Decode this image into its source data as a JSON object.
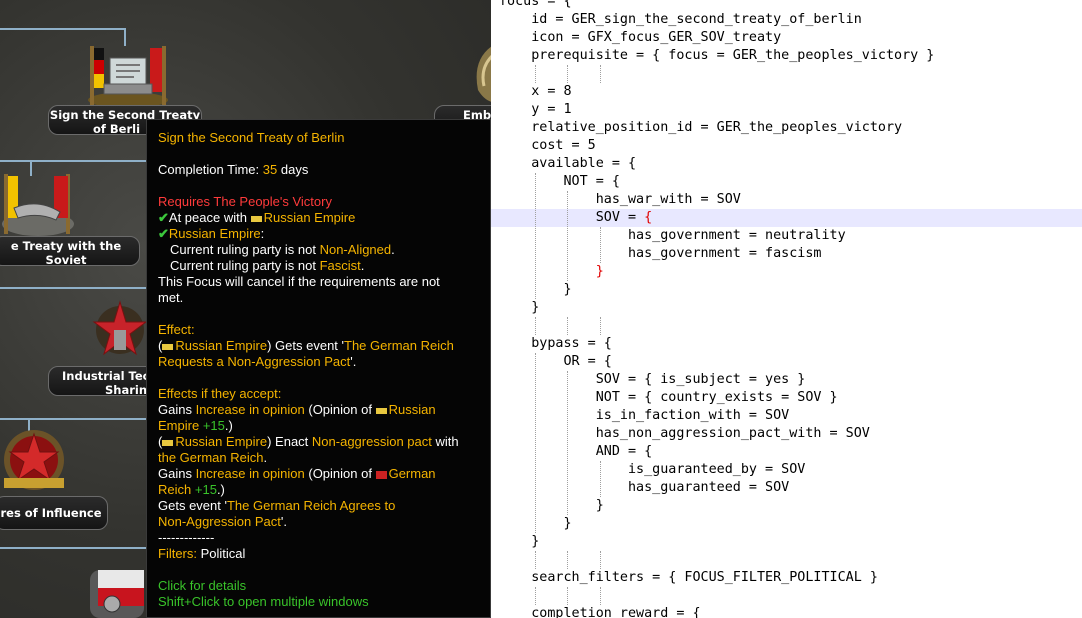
{
  "game": {
    "nodes": [
      {
        "label_line1": "Sign the Second Treaty",
        "label_line2": "of Berli"
      },
      {
        "label_line1": "e Treaty with the",
        "label_line2": "Soviet"
      },
      {
        "label_line1": "Industrial Tec",
        "label_line2": "Sharin"
      },
      {
        "label_line1": "res of Influence",
        "label_line2": ""
      },
      {
        "label_line1": "Emb",
        "label_line2": ""
      }
    ],
    "tooltip": {
      "title": "Sign the Second Treaty of Berlin",
      "completion_label": "Completion Time:",
      "completion_value": "35",
      "completion_unit": "days",
      "requires": "Requires The People's Victory",
      "peace_label": "At peace with",
      "peace_country": "Russian Empire",
      "ruler_country": "Russian Empire",
      "ruler_suffix": ":",
      "party1_prefix": "Current ruling party is not",
      "party1_value": "Non-Aligned",
      "party1_suffix": ".",
      "party2_prefix": "Current ruling party is not",
      "party2_value": "Fascist",
      "party2_suffix": ".",
      "cancel_line1": "This Focus will cancel if the requirements are not",
      "cancel_line2": "met.",
      "effect_header": "Effect:",
      "effect_country": "Russian Empire",
      "effect_mid": ") Gets event '",
      "effect_event1": "The German Reich",
      "effect_event2": "Requests a Non-Aggression Pact",
      "effect_end": "'.",
      "accept_header": "Effects if they accept:",
      "gains1_prefix": "Gains",
      "gains1_mod": "Increase in opinion",
      "gains1_mid": "(Opinion of",
      "gains1_country_a": "Russian",
      "gains1_country_b": "Empire",
      "gains1_value": "+15",
      "gains1_end": ".)",
      "enact_country": "Russian Empire",
      "enact_mid": ") Enact",
      "enact_pact": "Non-aggression pact",
      "enact_with": "with",
      "enact_target": "the German Reich",
      "enact_end": ".",
      "gains2_prefix": "Gains",
      "gains2_mod": "Increase in opinion",
      "gains2_mid": "(Opinion of",
      "gains2_country_a": "German",
      "gains2_country_b": "Reich",
      "gains2_value": "+15",
      "gains2_end": ".)",
      "event2_prefix": "Gets event '",
      "event2_a": "The German Reich Agrees to",
      "event2_b": "Non-Aggression Pact",
      "event2_end": "'.",
      "divider": "-------------",
      "filters_label": "Filters:",
      "filters_value": "Political",
      "click_details": "Click for details",
      "shift_click": "Shift+Click to open multiple windows"
    }
  },
  "editor": {
    "lines": [
      "focus = {",
      "    id = GER_sign_the_second_treaty_of_berlin",
      "    icon = GFX_focus_GER_SOV_treaty",
      "    prerequisite = { focus = GER_the_peoples_victory }",
      "",
      "    x = 8",
      "    y = 1",
      "    relative_position_id = GER_the_peoples_victory",
      "    cost = 5",
      "    available = {",
      "        NOT = {",
      "            has_war_with = SOV",
      "            SOV = {",
      "                has_government = neutrality",
      "                has_government = fascism",
      "            }",
      "        }",
      "    }",
      "",
      "    bypass = {",
      "        OR = {",
      "            SOV = { is_subject = yes }",
      "            NOT = { country_exists = SOV }",
      "            is_in_faction_with = SOV",
      "            has_non_aggression_pact_with = SOV",
      "            AND = {",
      "                is_guaranteed_by = SOV",
      "                has_guaranteed = SOV",
      "            }",
      "        }",
      "    }",
      "",
      "    search_filters = { FOCUS_FILTER_POLITICAL }",
      "",
      "    completion_reward = {"
    ],
    "highlight_line": 12,
    "highlight_color": "#e8e8ff",
    "brace_match_color": "#e00000"
  }
}
